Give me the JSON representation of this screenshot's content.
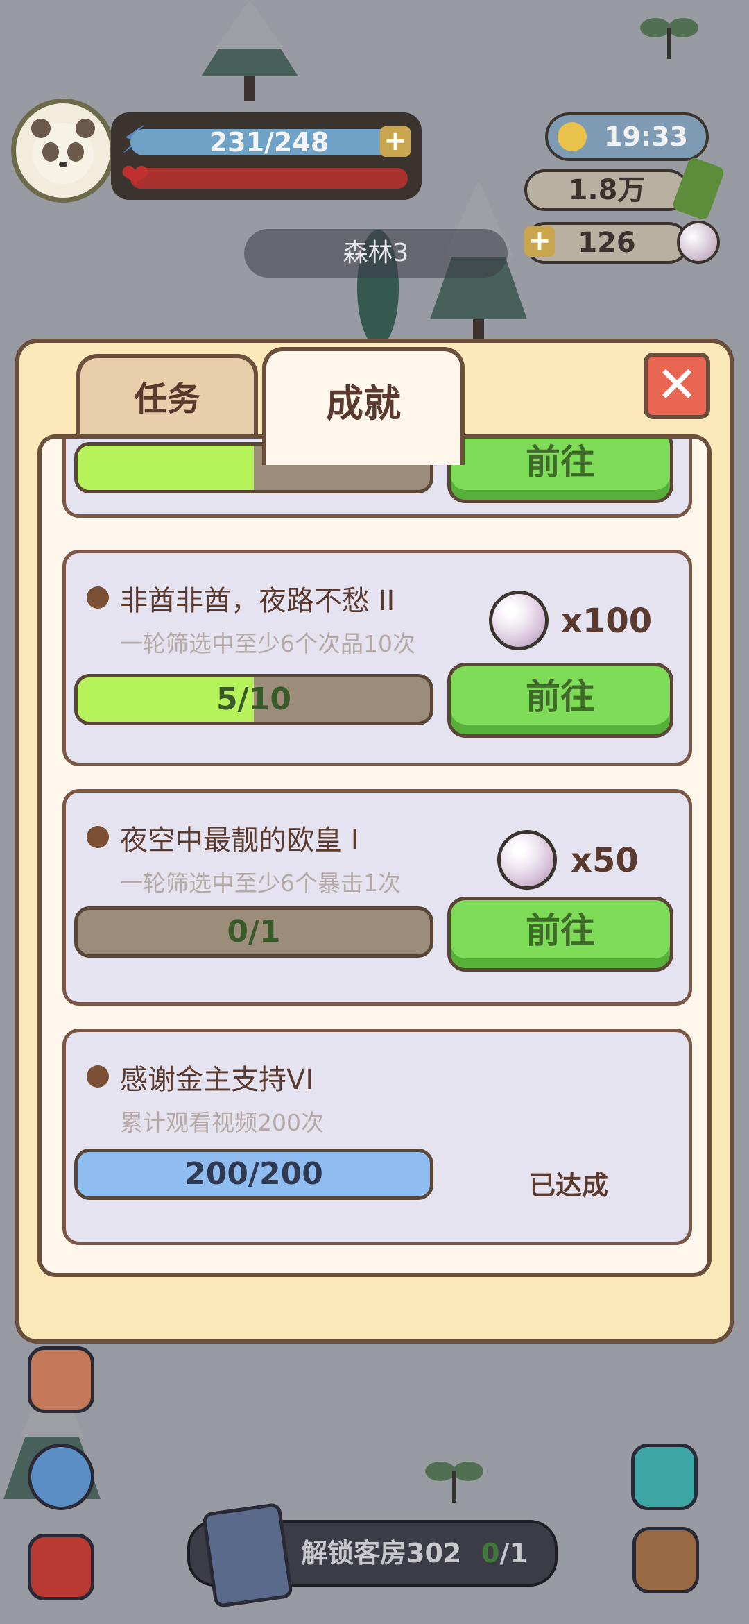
{
  "hud": {
    "energy": "231/248",
    "time": "19:33",
    "bamboo_amount": "1.8万",
    "pearl_amount": "126",
    "area_name": "森林3",
    "energy_icon": "lightning-icon",
    "health_icon": "heart-icon"
  },
  "dialog": {
    "tabs": [
      {
        "label": "任务",
        "active": false
      },
      {
        "label": "成就",
        "active": true
      }
    ],
    "close_icon": "close-x-icon",
    "cards": [
      {
        "title": "非酋非酋，夜路不愁 II",
        "desc": "一轮筛选中至少6个次品10次",
        "progress_text": "5/10",
        "progress_fraction": 0.5,
        "reward": "x100",
        "action": "前往"
      },
      {
        "title": "夜空中最靓的欧皇 I",
        "desc": "一轮筛选中至少6个暴击1次",
        "progress_text": "0/1",
        "progress_fraction": 0,
        "reward": "x50",
        "action": "前往"
      },
      {
        "title": "感谢金主支持VI",
        "desc": "累计观看视频200次",
        "progress_text": "200/200",
        "progress_fraction": 1,
        "status": "已达成"
      }
    ],
    "partial_top_card": {
      "action": "前往"
    }
  },
  "bottom": {
    "unlock_label": "解锁客房302",
    "unlock_current": "0",
    "unlock_total": "/1"
  },
  "colors": {
    "progress_green": "#b6f25a",
    "progress_blue": "#8fbdf0",
    "button_green": "#7fdc59",
    "panel_border": "#6b4e3c",
    "close_red": "#e86652"
  }
}
